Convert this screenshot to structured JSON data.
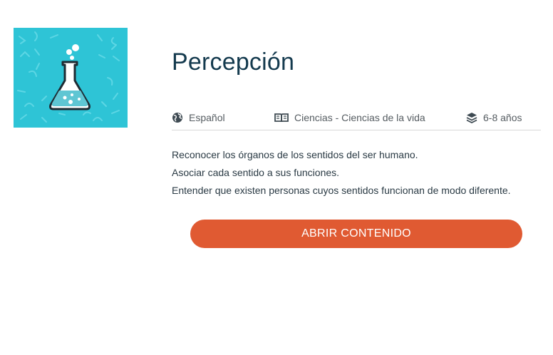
{
  "resource": {
    "title": "Percepción",
    "thumbnail_icon": "flask-icon",
    "thumbnail_color": "#2ec4d6"
  },
  "meta": {
    "language": "Español",
    "subject": "Ciencias - Ciencias de la vida",
    "age": "6-8 años",
    "language_icon": "globe-icon",
    "subject_icon": "book-icon",
    "age_icon": "layers-icon"
  },
  "objectives": [
    "Reconocer los órganos de los sentidos del ser humano.",
    "Asociar cada sentido a sus funciones.",
    "Entender que existen personas cuyos sentidos funcionan de modo diferente."
  ],
  "actions": {
    "open_label": "ABRIR CONTENIDO",
    "open_color": "#e05a32"
  }
}
